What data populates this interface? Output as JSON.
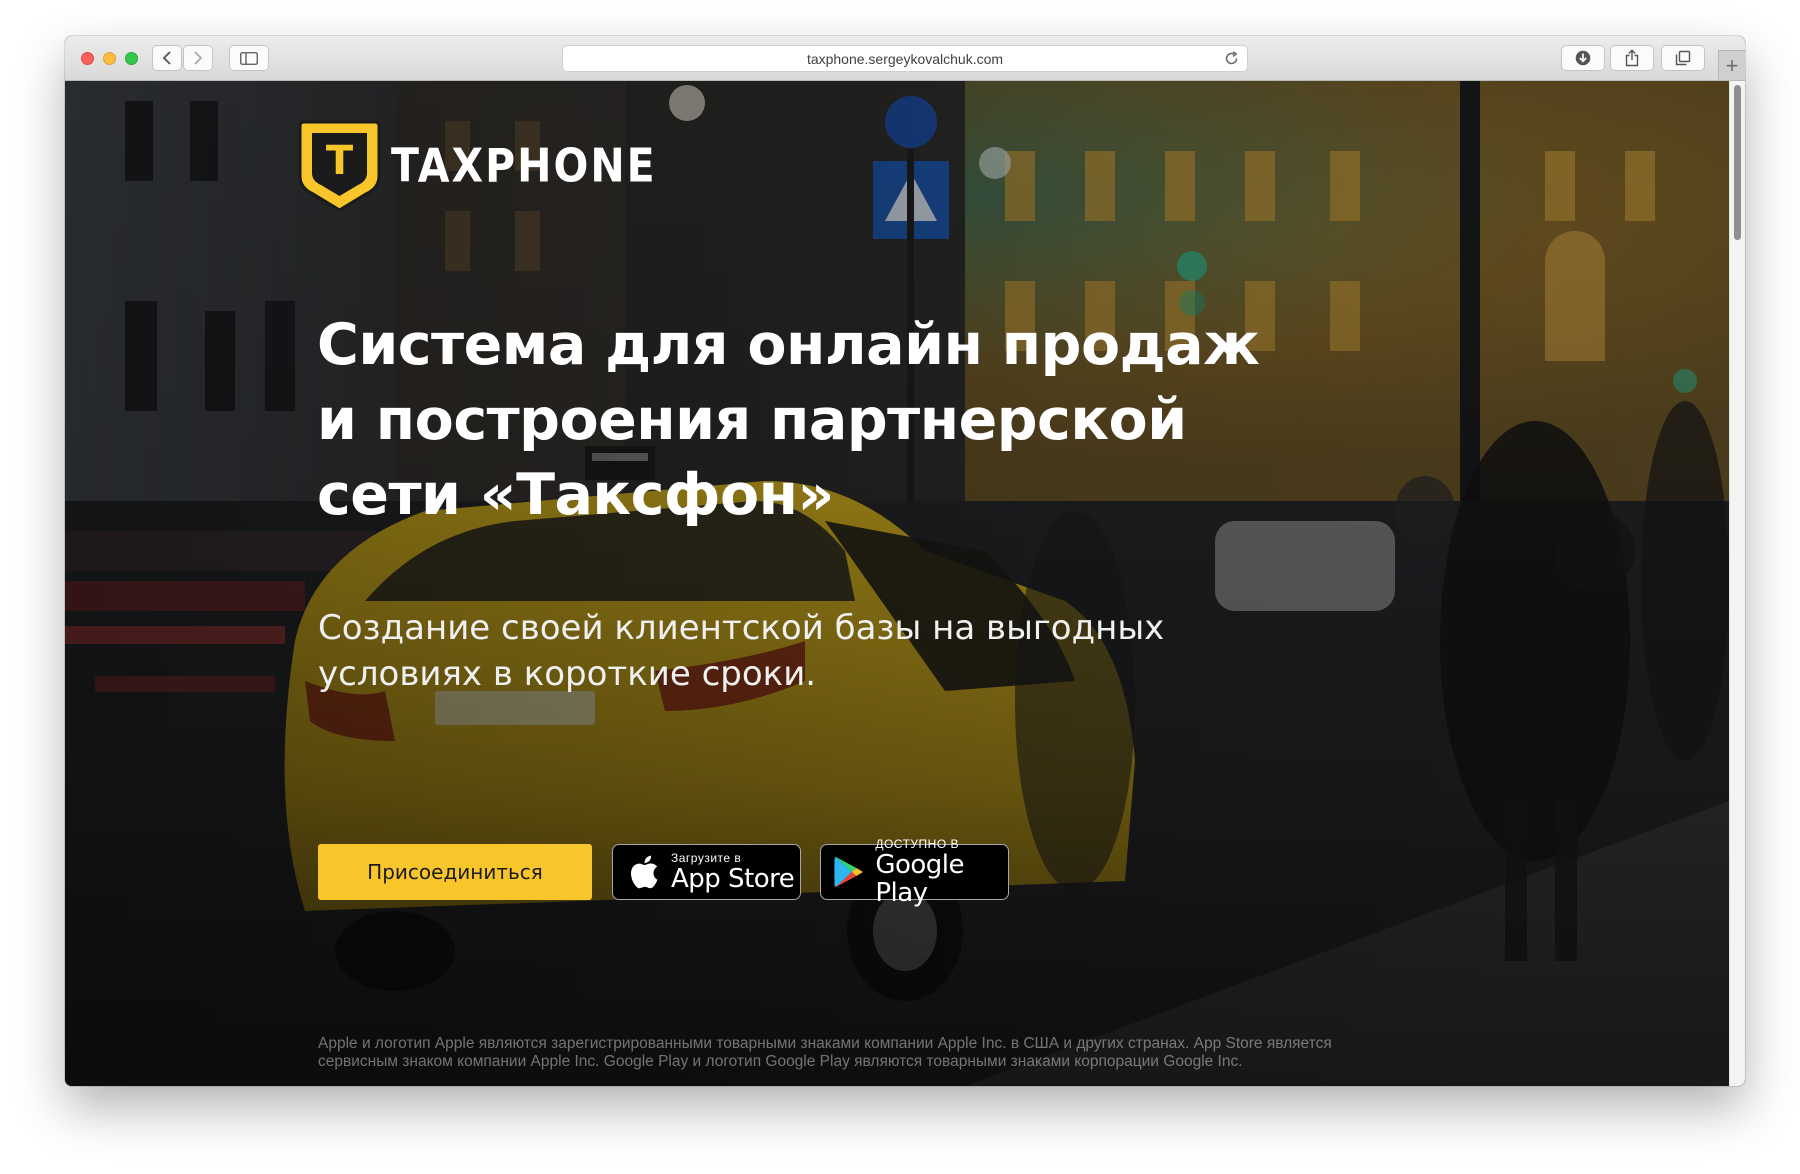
{
  "browser": {
    "url": "taxphone.sergeykovalchuk.com",
    "new_tab_label": "+"
  },
  "logo": {
    "mark_letter": "T",
    "wordmark": "TAXPHONE"
  },
  "hero": {
    "title_lines": [
      "Система для онлайн продаж",
      "и построения партнерской",
      "сети «Таксфон»"
    ],
    "subtitle_lines": [
      "Создание своей клиентской базы на выгодных",
      "условиях в короткие сроки."
    ]
  },
  "actions": {
    "join_label": "Присоединиться",
    "appstore_small": "Загрузите в",
    "appstore_big": "App Store",
    "googleplay_small": "ДОСТУПНО В",
    "googleplay_big": "Google Play"
  },
  "footer": {
    "disclaimer_lines": [
      "Apple и логотип Apple являются зарегистрированными товарными знаками компании Apple Inc. в США и других странах. App Store является",
      "сервисным знаком компании Apple Inc. Google Play и логотип Google Play являются товарными знаками корпорации Google Inc."
    ]
  },
  "colors": {
    "accent_yellow": "#f8c52a",
    "taxi_yellow": "#d9b21a"
  },
  "icons": [
    "back-icon",
    "forward-icon",
    "sidebar-icon",
    "reload-icon",
    "download-icon",
    "share-icon",
    "tabs-icon",
    "apple-icon",
    "google-play-icon"
  ]
}
